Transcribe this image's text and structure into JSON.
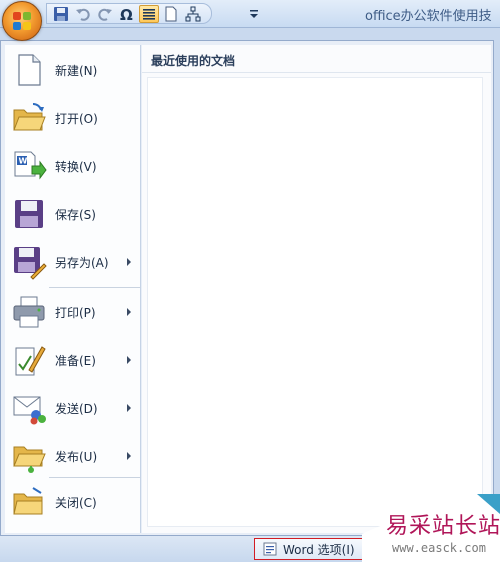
{
  "window": {
    "title": "office办公软件使用技"
  },
  "quick_access": {
    "items": [
      {
        "name": "save-icon"
      },
      {
        "name": "undo-icon"
      },
      {
        "name": "redo-icon"
      },
      {
        "name": "symbol-omega-icon"
      },
      {
        "name": "align-icon"
      },
      {
        "name": "page-icon"
      },
      {
        "name": "org-chart-icon"
      },
      {
        "name": "customize-qat-icon"
      }
    ]
  },
  "menu": {
    "items": [
      {
        "label": "新建(N)",
        "icon": "new-document-icon",
        "submenu": false
      },
      {
        "label": "打开(O)",
        "icon": "open-folder-icon",
        "submenu": false
      },
      {
        "label": "转换(V)",
        "icon": "convert-icon",
        "submenu": false
      },
      {
        "label": "保存(S)",
        "icon": "save-disk-icon",
        "submenu": false
      },
      {
        "label": "另存为(A)",
        "icon": "save-as-icon",
        "submenu": true
      },
      {
        "label": "打印(P)",
        "icon": "printer-icon",
        "submenu": true
      },
      {
        "label": "准备(E)",
        "icon": "prepare-icon",
        "submenu": true
      },
      {
        "label": "发送(D)",
        "icon": "send-icon",
        "submenu": true
      },
      {
        "label": "发布(U)",
        "icon": "publish-icon",
        "submenu": true
      },
      {
        "label": "关闭(C)",
        "icon": "close-folder-icon",
        "submenu": false
      }
    ],
    "recent_header": "最近使用的文档"
  },
  "footer": {
    "word_options_label": "Word 选项(I)"
  },
  "watermark": {
    "text": "易采站长站",
    "url": "www.easck.com"
  },
  "colors": {
    "office_button": "#f29a2e",
    "highlight_border": "#d21c24",
    "watermark": "#b01558"
  }
}
